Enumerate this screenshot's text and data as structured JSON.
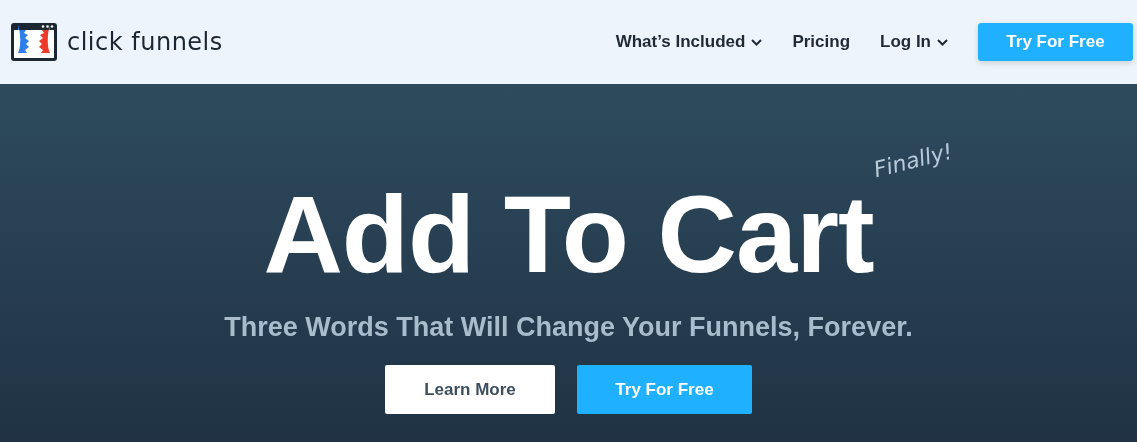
{
  "header": {
    "logo_text": "click funnels",
    "nav": [
      {
        "label": "What’s Included",
        "has_menu": true
      },
      {
        "label": "Pricing",
        "has_menu": false
      },
      {
        "label": "Log In",
        "has_menu": true
      }
    ],
    "cta": "Try For Free"
  },
  "hero": {
    "tagline": "Finally!",
    "title": "Add To Cart",
    "subtitle": "Three Words That Will Change Your Funnels, Forever.",
    "buttons": [
      {
        "label": "Learn More",
        "kind": "secondary"
      },
      {
        "label": "Try For Free",
        "kind": "primary"
      }
    ]
  }
}
